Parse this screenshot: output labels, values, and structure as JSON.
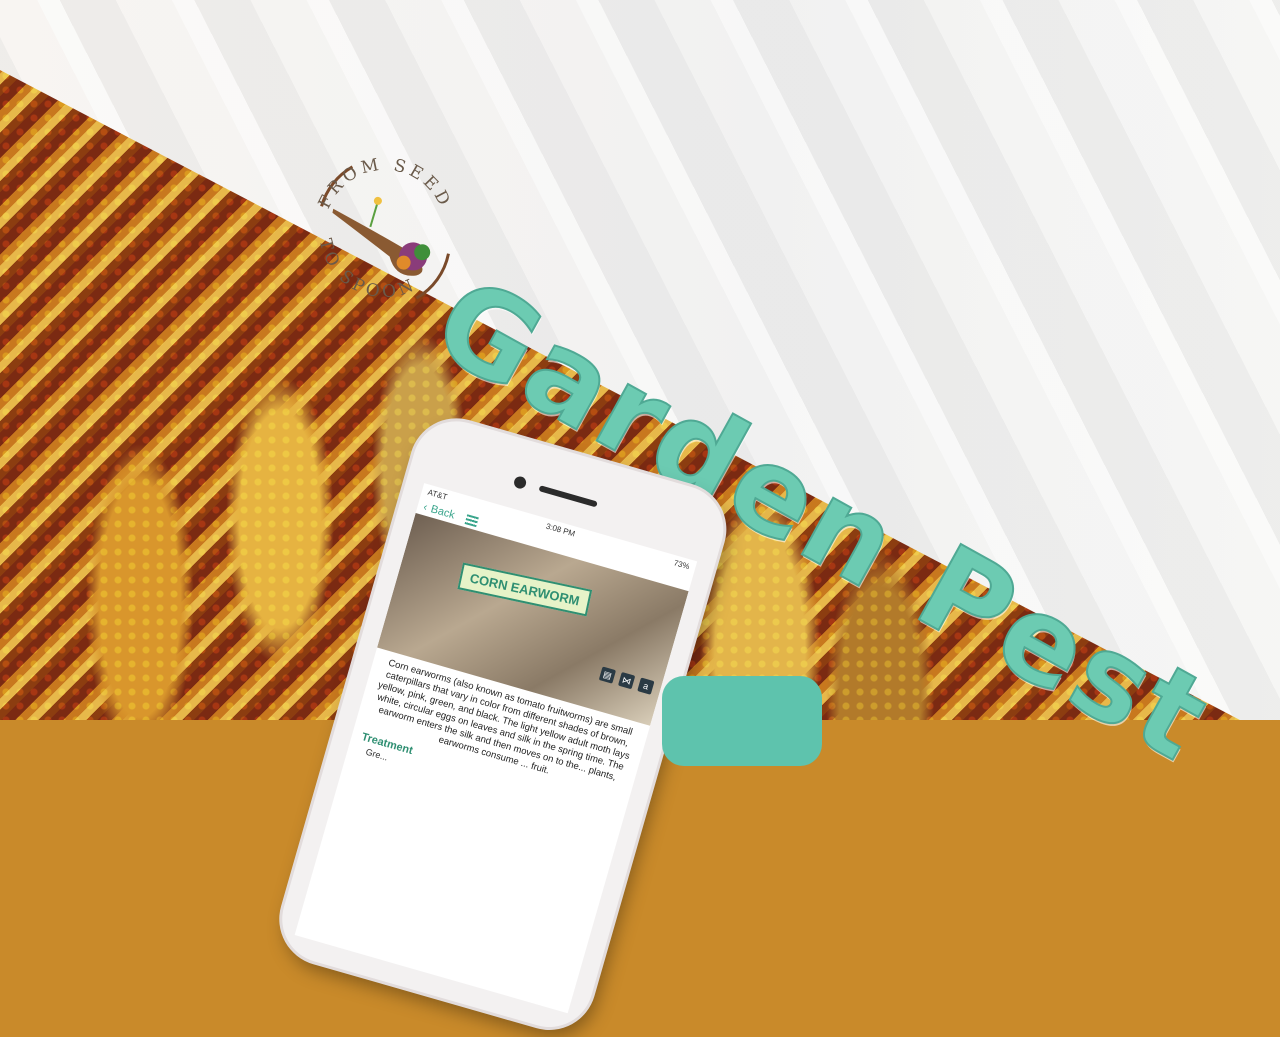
{
  "logo": {
    "top_text": "FROM SEED",
    "bottom_text": "TO SPOON"
  },
  "title": "Garden Pest",
  "colors": {
    "title_teal": "#6ccbb2",
    "accent_teal": "#3aa58c",
    "button_teal": "#5ec3ad",
    "banner_white": "#f2f0ec"
  },
  "phone": {
    "status_carrier": "AT&T",
    "status_time": "3:08 PM",
    "status_battery": "73%",
    "back_label": "Back",
    "hero_label": "CORN EARWORM",
    "icons": [
      "print-icon",
      "share-icon",
      "amazon-icon"
    ],
    "body_text": "Corn earworms (also known as tomato fruitworms) are small caterpillars that vary in color from different shades of brown, yellow, pink, green, and black. The light yellow adult moth lays white, circular eggs on leaves and silk in the spring time. The earworm enters the silk and then moves on to the... plants, earworms consume ... fruit.",
    "treatment_heading": "Treatment",
    "treatment_item": "Gre..."
  }
}
